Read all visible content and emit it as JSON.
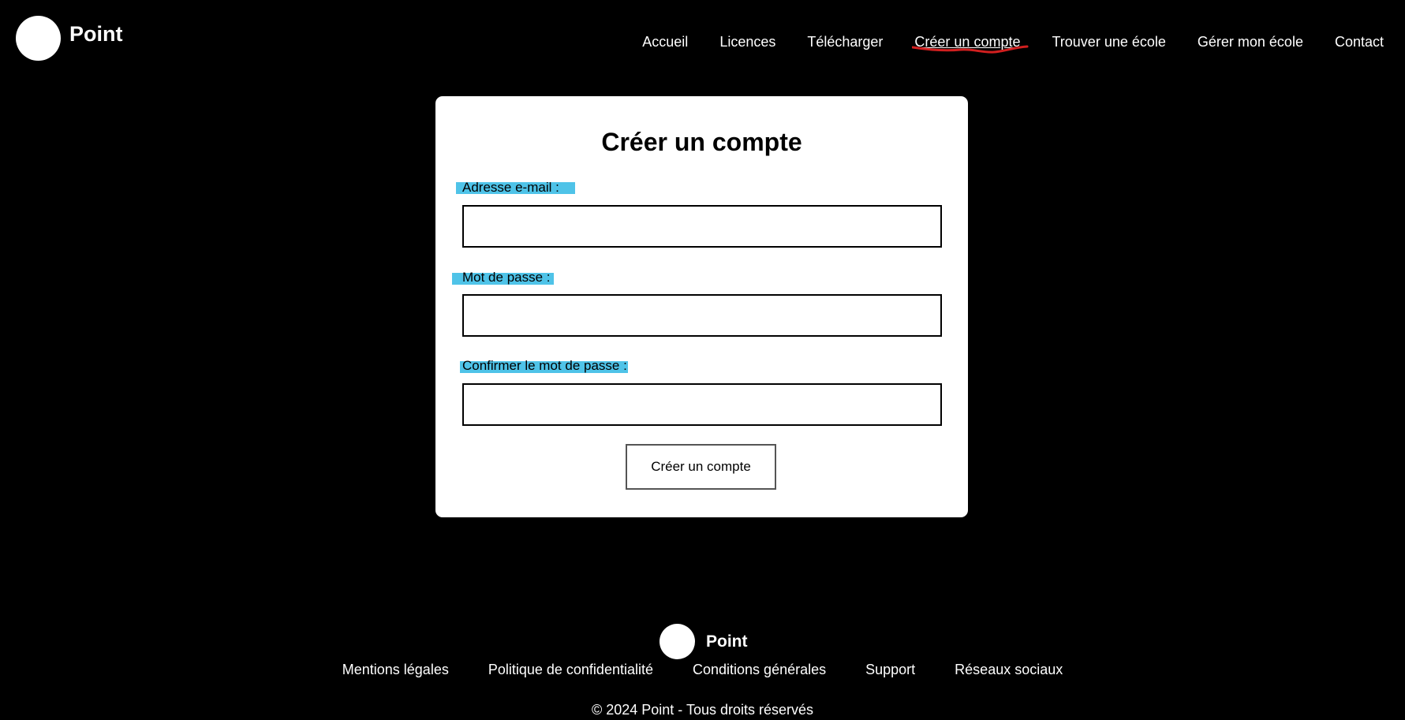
{
  "header": {
    "brand": "Point",
    "nav": [
      {
        "label": "Accueil"
      },
      {
        "label": "Licences"
      },
      {
        "label": "Télécharger"
      },
      {
        "label": "Créer un compte",
        "active": true
      },
      {
        "label": "Trouver une école"
      },
      {
        "label": "Gérer mon école"
      },
      {
        "label": "Contact"
      }
    ]
  },
  "form": {
    "title": "Créer un compte",
    "email_label": "Adresse e-mail :",
    "email_value": "",
    "password_label": "Mot de passe",
    "password_value": "",
    "confirm_label": "Confirmer le mot de passe",
    "confirm_value": "",
    "label_colon": ":",
    "submit_label": "Créer un compte"
  },
  "footer": {
    "brand": "Point",
    "links": [
      {
        "label": "Mentions légales"
      },
      {
        "label": "Politique de confidentialité"
      },
      {
        "label": "Conditions générales"
      },
      {
        "label": "Support"
      },
      {
        "label": "Réseaux sociaux"
      }
    ],
    "copyright": "© 2024 Point - Tous droits réservés"
  },
  "colors": {
    "background": "#000000",
    "card": "#ffffff",
    "highlight": "#4fc3e8",
    "annotation": "#d11f1f"
  }
}
